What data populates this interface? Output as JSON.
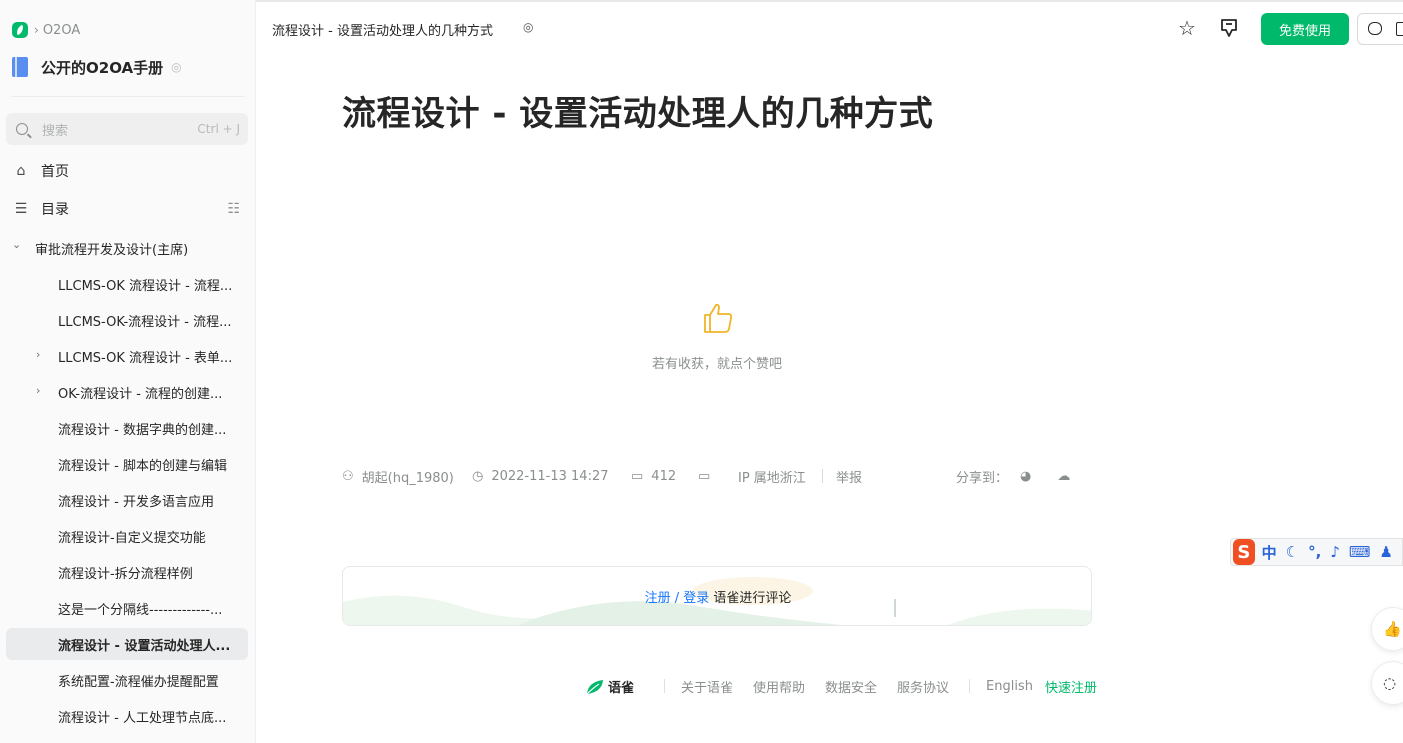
{
  "sidebar": {
    "breadcrumb": "O2OA",
    "book_title": "公开的O2OA手册",
    "search": {
      "placeholder": "搜索",
      "shortcut": "Ctrl + J"
    },
    "nav": {
      "home": "首页",
      "toc": "目录"
    },
    "tree": [
      {
        "label": "审批流程开发及设计(主席)",
        "depth": 0,
        "caret": "down",
        "active": false
      },
      {
        "label": "LLCMS-OK 流程设计 - 流程...",
        "depth": 1,
        "caret": "",
        "active": false
      },
      {
        "label": "LLCMS-OK-流程设计 - 流程...",
        "depth": 1,
        "caret": "",
        "active": false
      },
      {
        "label": "LLCMS-OK 流程设计 - 表单...",
        "depth": 1,
        "caret": "right",
        "active": false
      },
      {
        "label": "OK-流程设计 - 流程的创建...",
        "depth": 1,
        "caret": "right",
        "active": false
      },
      {
        "label": "流程设计 - 数据字典的创建...",
        "depth": 1,
        "caret": "",
        "active": false
      },
      {
        "label": "流程设计 - 脚本的创建与编辑",
        "depth": 1,
        "caret": "",
        "active": false
      },
      {
        "label": "流程设计 - 开发多语言应用",
        "depth": 1,
        "caret": "",
        "active": false
      },
      {
        "label": "流程设计-自定义提交功能",
        "depth": 1,
        "caret": "",
        "active": false
      },
      {
        "label": "流程设计-拆分流程样例",
        "depth": 1,
        "caret": "",
        "active": false
      },
      {
        "label": "这是一个分隔线-------------...",
        "depth": 1,
        "caret": "",
        "active": false
      },
      {
        "label": "流程设计 - 设置活动处理人...",
        "depth": 1,
        "caret": "",
        "active": true
      },
      {
        "label": "系统配置-流程催办提醒配置",
        "depth": 1,
        "caret": "",
        "active": false
      },
      {
        "label": "流程设计 - 人工处理节点底...",
        "depth": 1,
        "caret": "",
        "active": false
      }
    ]
  },
  "header": {
    "doc_title": "流程设计 - 设置活动处理人的几种方式",
    "free_button": "免费使用"
  },
  "main": {
    "title": "流程设计 - 设置活动处理人的几种方式",
    "like_prompt": "若有收获，就点个赞吧",
    "meta": {
      "author": "胡起(hq_1980)",
      "datetime": "2022-11-13 14:27",
      "reads": "412",
      "ip_location": "IP 属地浙江",
      "report": "举报",
      "share_label": "分享到："
    },
    "comment": {
      "register": "注册",
      "slash": " / ",
      "login": "登录",
      "suffix": " 语雀进行评论"
    }
  },
  "footer": {
    "brand": "语雀",
    "links": [
      "关于语雀",
      "使用帮助",
      "数据安全",
      "服务协议"
    ],
    "language": "English",
    "signup": "快速注册"
  },
  "ime": {
    "mode": "中"
  },
  "colors": {
    "accent": "#00b96b",
    "link": "#1677ff",
    "active_bg": "#eaebec",
    "ime_logo": "#f04e23"
  },
  "icons": [
    "logo-icon",
    "book-icon",
    "search-icon",
    "home-icon",
    "toc-icon",
    "star-icon",
    "pin-icon",
    "thumbs-up-icon",
    "user-icon",
    "clock-icon",
    "book-open-icon",
    "comment-icon",
    "weibo-icon",
    "wechat-icon"
  ]
}
